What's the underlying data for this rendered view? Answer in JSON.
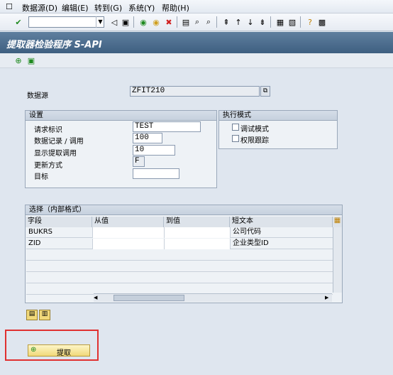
{
  "menu": [
    "数据源(D)",
    "编辑(E)",
    "转到(G)",
    "系统(Y)",
    "帮助(H)"
  ],
  "icons": {
    "enter": "check-icon",
    "back": "back-icon",
    "exit": "exit-icon",
    "cancel": "cancel-icon",
    "save": "save-icon",
    "print": "print-icon",
    "find": "find-icon",
    "help": "help-icon",
    "execute": "execute-icon",
    "variant": "variant-icon"
  },
  "title": "提取器检验程序 S-API",
  "datasource": {
    "label": "数据源",
    "value": "ZFIT210"
  },
  "settings": {
    "title": "设置",
    "request_label": "请求标识",
    "request_value": "TEST",
    "records_label": "数据记录 / 调用",
    "records_value": "100",
    "display_label": "显示提取调用",
    "display_value": "10",
    "update_label": "更新方式",
    "update_value": "F",
    "target_label": "目标",
    "target_value": ""
  },
  "exec": {
    "title": "执行模式",
    "debug_label": "调试模式",
    "auth_label": "权限跟踪"
  },
  "selection": {
    "title": "选择（内部格式）",
    "columns": [
      "字段",
      "从值",
      "到值",
      "短文本"
    ],
    "rows": [
      [
        "BUKRS",
        "",
        "",
        "公司代码"
      ],
      [
        "ZID",
        "",
        "",
        "企业类型ID"
      ]
    ]
  },
  "extract_label": "提取",
  "colors": {
    "title_bg": "#4a6b8c",
    "highlight": "#e03030",
    "button": "#f1d97a"
  }
}
